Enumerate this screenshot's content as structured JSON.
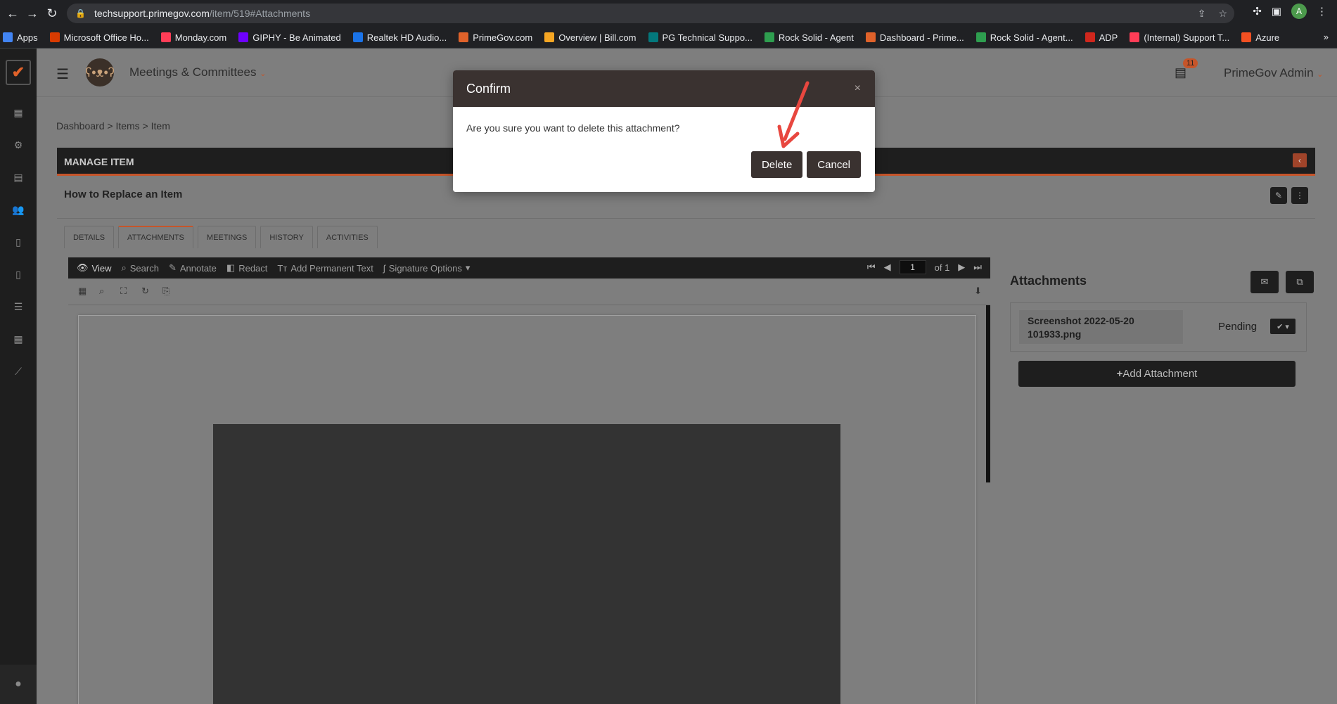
{
  "browser": {
    "url_host": "techsupport.primegov.com",
    "url_path": "/item/519#Attachments",
    "profile_initial": "A",
    "bookmarks": [
      {
        "label": "Apps",
        "color": "#4285f4"
      },
      {
        "label": "Microsoft Office Ho...",
        "color": "#d83b01"
      },
      {
        "label": "Monday.com",
        "color": "#ff3d57"
      },
      {
        "label": "GIPHY - Be Animated",
        "color": "#6e00ff"
      },
      {
        "label": "Realtek HD Audio...",
        "color": "#1a73e8"
      },
      {
        "label": "PrimeGov.com",
        "color": "#e0622a"
      },
      {
        "label": "Overview | Bill.com",
        "color": "#f5a623"
      },
      {
        "label": "PG Technical Suppo...",
        "color": "#03787c"
      },
      {
        "label": "Rock Solid - Agent",
        "color": "#2e9e4f"
      },
      {
        "label": "Dashboard - Prime...",
        "color": "#e0622a"
      },
      {
        "label": "Rock Solid - Agent...",
        "color": "#2e9e4f"
      },
      {
        "label": "ADP",
        "color": "#d0271d"
      },
      {
        "label": "(Internal) Support T...",
        "color": "#ff3d57"
      },
      {
        "label": "Azure",
        "color": "#f25022"
      }
    ],
    "more": "»"
  },
  "app": {
    "module": "Meetings & Committees",
    "notification_count": "11",
    "admin_name": "PrimeGov Admin",
    "breadcrumb": "Dashboard > Items > Item",
    "manage_title": "MANAGE ITEM",
    "item_title": "How to Replace an Item",
    "tabs": [
      "DETAILS",
      "ATTACHMENTS",
      "MEETINGS",
      "HISTORY",
      "ACTIVITIES"
    ],
    "active_tab": "ATTACHMENTS"
  },
  "viewer": {
    "toolbar": [
      "View",
      "Search",
      "Annotate",
      "Redact",
      "Add Permanent Text",
      "Signature Options"
    ],
    "page_current": "1",
    "page_total": "of 1"
  },
  "attachments": {
    "title": "Attachments",
    "file_name_line1": "Screenshot 2022-05-20",
    "file_name_line2": "101933.png",
    "status": "Pending",
    "add_label": "Add Attachment"
  },
  "modal": {
    "title": "Confirm",
    "message": "Are you sure you want to delete this attachment?",
    "delete_label": "Delete",
    "cancel_label": "Cancel",
    "close_symbol": "×"
  },
  "colors": {
    "accent": "#c5552a",
    "modal_header": "#3a3230",
    "arrow": "#e8473f"
  }
}
